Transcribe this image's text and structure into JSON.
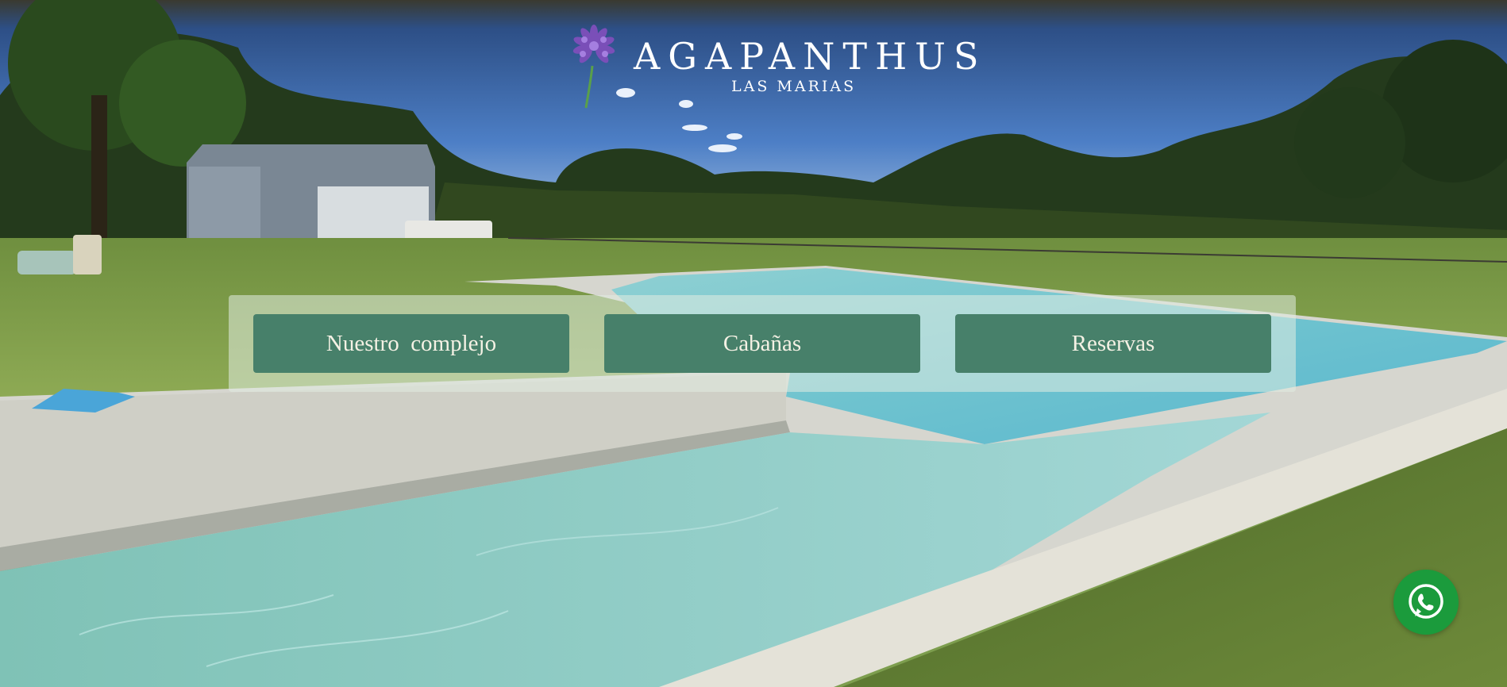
{
  "logo": {
    "brand": "AGAPANTHUS",
    "subtitle": "LAS MARIAS",
    "icon": "agapanthus-flower-icon"
  },
  "nav": {
    "buttons": [
      {
        "label": "Nuestro  complejo"
      },
      {
        "label": "Cabañas"
      },
      {
        "label": "Reservas"
      }
    ]
  },
  "floating": {
    "whatsapp_icon": "whatsapp-icon"
  },
  "colors": {
    "button_bg": "#47806a",
    "button_text": "#f4f1e4",
    "panel_bg": "#e2ece1",
    "whatsapp": "#1b9b3c"
  }
}
